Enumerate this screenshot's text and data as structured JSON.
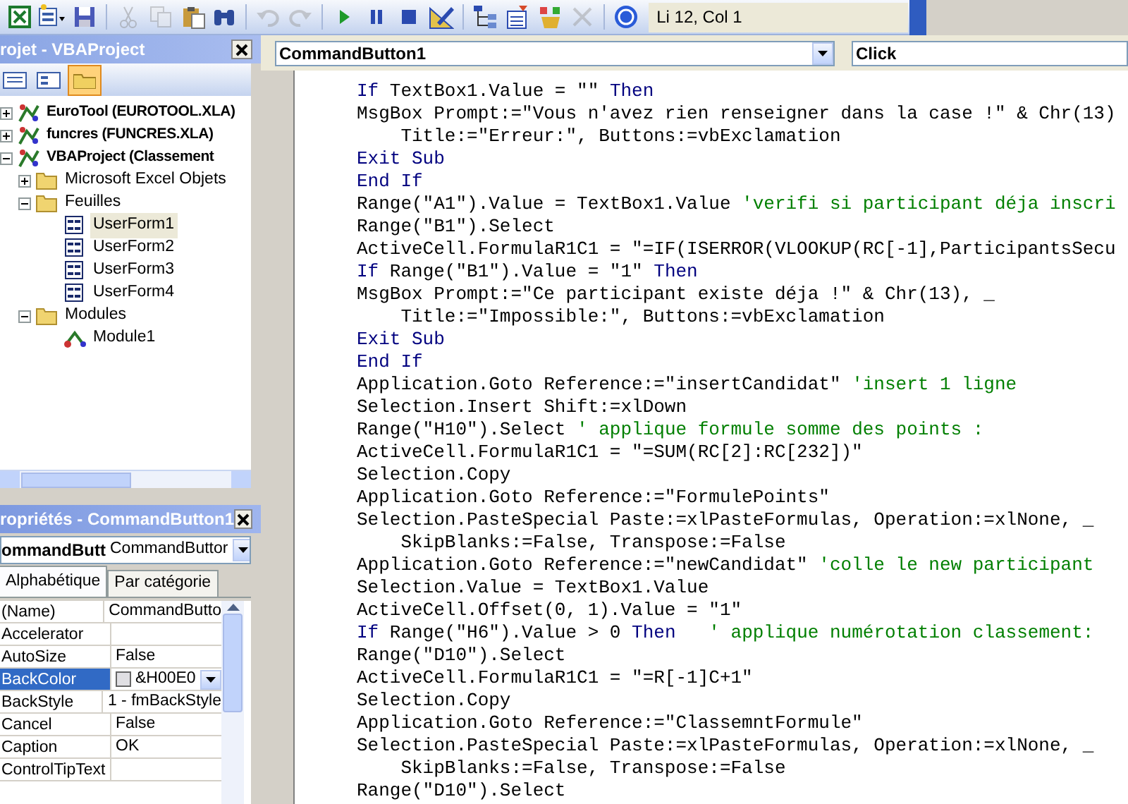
{
  "toolbar": {
    "items": [
      {
        "kind": "excel",
        "disabled": false
      },
      {
        "kind": "userform",
        "disabled": false
      },
      {
        "kind": "save",
        "disabled": false
      },
      {
        "kind": "separator"
      },
      {
        "kind": "cut",
        "disabled": true
      },
      {
        "kind": "copy",
        "disabled": true
      },
      {
        "kind": "paste",
        "disabled": false
      },
      {
        "kind": "find",
        "disabled": false
      },
      {
        "kind": "separator"
      },
      {
        "kind": "undo",
        "disabled": true
      },
      {
        "kind": "redo",
        "disabled": true
      },
      {
        "kind": "separator"
      },
      {
        "kind": "run",
        "disabled": false
      },
      {
        "kind": "pause",
        "disabled": false
      },
      {
        "kind": "stop",
        "disabled": false
      },
      {
        "kind": "design",
        "disabled": false
      },
      {
        "kind": "separator"
      },
      {
        "kind": "explorer",
        "disabled": false
      },
      {
        "kind": "properties",
        "disabled": false
      },
      {
        "kind": "browser",
        "disabled": false
      },
      {
        "kind": "toolbox",
        "disabled": true
      },
      {
        "kind": "separator"
      },
      {
        "kind": "help",
        "disabled": false
      }
    ],
    "status": "Li 12, Col 1"
  },
  "project_pane": {
    "title": "rojet - VBAProject",
    "folders_toggled": true,
    "tree": [
      {
        "label": "EuroTool (EUROTOOL.XLA)",
        "kind": "project",
        "expanded": false,
        "selected": false
      },
      {
        "label": "funcres (FUNCRES.XLA)",
        "kind": "project",
        "expanded": false,
        "selected": false
      },
      {
        "label": "VBAProject (Classement",
        "kind": "project",
        "expanded": true,
        "selected": false,
        "children": [
          {
            "label": "Microsoft Excel Objets",
            "kind": "folder",
            "expanded": false,
            "selected": false
          },
          {
            "label": "Feuilles",
            "kind": "folder",
            "expanded": true,
            "selected": false,
            "children": [
              {
                "label": "UserForm1",
                "kind": "form",
                "selected": true
              },
              {
                "label": "UserForm2",
                "kind": "form",
                "selected": false
              },
              {
                "label": "UserForm3",
                "kind": "form",
                "selected": false
              },
              {
                "label": "UserForm4",
                "kind": "form",
                "selected": false
              }
            ]
          },
          {
            "label": "Modules",
            "kind": "folder",
            "expanded": true,
            "selected": false,
            "children": [
              {
                "label": "Module1",
                "kind": "module",
                "selected": false
              }
            ]
          }
        ]
      }
    ]
  },
  "properties_pane": {
    "title": "ropriétés - CommandButton1",
    "object_name": "ommandButt",
    "object_type": "CommandButtor",
    "tabs": [
      {
        "label": "Alphabétique",
        "selected": true
      },
      {
        "label": "Par catégorie",
        "selected": false
      }
    ],
    "rows": [
      {
        "name": "(Name)",
        "value": "CommandButto",
        "kind": "text",
        "selected": false
      },
      {
        "name": "Accelerator",
        "value": "",
        "kind": "text",
        "selected": false
      },
      {
        "name": "AutoSize",
        "value": "False",
        "kind": "text",
        "selected": false
      },
      {
        "name": "BackColor",
        "value": "&H00E0",
        "kind": "color",
        "selected": true
      },
      {
        "name": "BackStyle",
        "value": "1 - fmBackStyle",
        "kind": "text",
        "selected": false
      },
      {
        "name": "Cancel",
        "value": "False",
        "kind": "text",
        "selected": false
      },
      {
        "name": "Caption",
        "value": "OK",
        "kind": "text",
        "selected": false
      },
      {
        "name": "ControlTipText",
        "value": "",
        "kind": "text",
        "selected": false
      }
    ]
  },
  "code_window": {
    "object": "CommandButton1",
    "procedure": "Click",
    "lines": [
      [
        {
          "kind": "keyword",
          "text": "If"
        },
        {
          "kind": "plain",
          "text": " TextBox1.Value = \"\" "
        },
        {
          "kind": "keyword",
          "text": "Then"
        }
      ],
      [
        {
          "kind": "plain",
          "text": "MsgBox Prompt:=\"Vous n'avez rien renseigner dans la case !\" & Chr(13)"
        }
      ],
      [
        {
          "kind": "plain",
          "text": "    Title:=\"Erreur:\", Buttons:=vbExclamation"
        }
      ],
      [
        {
          "kind": "keyword",
          "text": "Exit Sub"
        }
      ],
      [
        {
          "kind": "keyword",
          "text": "End If"
        }
      ],
      [
        {
          "kind": "plain",
          "text": "Range(\"A1\").Value = TextBox1.Value "
        },
        {
          "kind": "comment",
          "text": "'verifi si participant déja inscri"
        }
      ],
      [
        {
          "kind": "plain",
          "text": "Range(\"B1\").Select"
        }
      ],
      [
        {
          "kind": "plain",
          "text": "ActiveCell.FormulaR1C1 = \"=IF(ISERROR(VLOOKUP(RC[-1],ParticipantsSecu"
        }
      ],
      [
        {
          "kind": "keyword",
          "text": "If"
        },
        {
          "kind": "plain",
          "text": " Range(\"B1\").Value = \"1\" "
        },
        {
          "kind": "keyword",
          "text": "Then"
        }
      ],
      [
        {
          "kind": "plain",
          "text": "MsgBox Prompt:=\"Ce participant existe déja !\" & Chr(13), _"
        }
      ],
      [
        {
          "kind": "plain",
          "text": "    Title:=\"Impossible:\", Buttons:=vbExclamation"
        }
      ],
      [
        {
          "kind": "keyword",
          "text": "Exit Sub"
        }
      ],
      [
        {
          "kind": "keyword",
          "text": "End If"
        }
      ],
      [
        {
          "kind": "plain",
          "text": "Application.Goto Reference:=\"insertCandidat\" "
        },
        {
          "kind": "comment",
          "text": "'insert 1 ligne"
        }
      ],
      [
        {
          "kind": "plain",
          "text": "Selection.Insert Shift:=xlDown"
        }
      ],
      [
        {
          "kind": "plain",
          "text": "Range(\"H10\").Select "
        },
        {
          "kind": "comment",
          "text": "' applique formule somme des points :"
        }
      ],
      [
        {
          "kind": "plain",
          "text": "ActiveCell.FormulaR1C1 = \"=SUM(RC[2]:RC[232])\""
        }
      ],
      [
        {
          "kind": "plain",
          "text": "Selection.Copy"
        }
      ],
      [
        {
          "kind": "plain",
          "text": "Application.Goto Reference:=\"FormulePoints\""
        }
      ],
      [
        {
          "kind": "plain",
          "text": "Selection.PasteSpecial Paste:=xlPasteFormulas, Operation:=xlNone, _"
        }
      ],
      [
        {
          "kind": "plain",
          "text": "    SkipBlanks:=False, Transpose:=False"
        }
      ],
      [
        {
          "kind": "plain",
          "text": "Application.Goto Reference:=\"newCandidat\" "
        },
        {
          "kind": "comment",
          "text": "'colle le new participant"
        }
      ],
      [
        {
          "kind": "plain",
          "text": "Selection.Value = TextBox1.Value"
        }
      ],
      [
        {
          "kind": "plain",
          "text": "ActiveCell.Offset(0, 1).Value = \"1\""
        }
      ],
      [
        {
          "kind": "keyword",
          "text": "If"
        },
        {
          "kind": "plain",
          "text": " Range(\"H6\").Value > 0 "
        },
        {
          "kind": "keyword",
          "text": "Then"
        },
        {
          "kind": "comment",
          "text": "   ' applique numérotation classement:"
        }
      ],
      [
        {
          "kind": "plain",
          "text": "Range(\"D10\").Select"
        }
      ],
      [
        {
          "kind": "plain",
          "text": "ActiveCell.FormulaR1C1 = \"=R[-1]C+1\""
        }
      ],
      [
        {
          "kind": "plain",
          "text": "Selection.Copy"
        }
      ],
      [
        {
          "kind": "plain",
          "text": "Application.Goto Reference:=\"ClassemntFormule\""
        }
      ],
      [
        {
          "kind": "plain",
          "text": "Selection.PasteSpecial Paste:=xlPasteFormulas, Operation:=xlNone, _"
        }
      ],
      [
        {
          "kind": "plain",
          "text": "    SkipBlanks:=False, Transpose:=False"
        }
      ],
      [
        {
          "kind": "plain",
          "text": "Range(\"D10\").Select"
        }
      ]
    ]
  }
}
